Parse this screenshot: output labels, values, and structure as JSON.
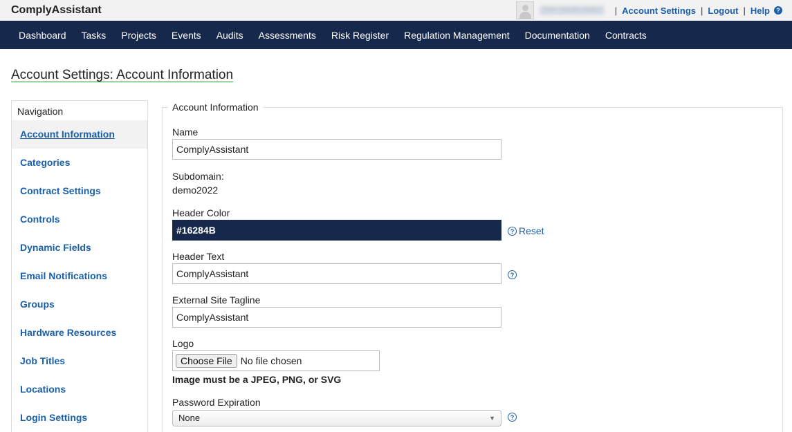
{
  "app": {
    "brand": "ComplyAssistant"
  },
  "topbar": {
    "username": "John Vandervalden",
    "separator": "|",
    "links": [
      {
        "label": "Account Settings"
      },
      {
        "label": "Logout"
      },
      {
        "label": "Help"
      }
    ],
    "help_icon_glyph": "?"
  },
  "nav": {
    "items": [
      {
        "label": "Dashboard"
      },
      {
        "label": "Tasks"
      },
      {
        "label": "Projects"
      },
      {
        "label": "Events"
      },
      {
        "label": "Audits"
      },
      {
        "label": "Assessments"
      },
      {
        "label": "Risk Register"
      },
      {
        "label": "Regulation Management"
      },
      {
        "label": "Documentation"
      },
      {
        "label": "Contracts"
      }
    ]
  },
  "page": {
    "title": "Account Settings: Account Information"
  },
  "sidebar": {
    "header": "Navigation",
    "items": [
      {
        "label": "Account Information"
      },
      {
        "label": "Categories"
      },
      {
        "label": "Contract Settings"
      },
      {
        "label": "Controls"
      },
      {
        "label": "Dynamic Fields"
      },
      {
        "label": "Email Notifications"
      },
      {
        "label": "Groups"
      },
      {
        "label": "Hardware Resources"
      },
      {
        "label": "Job Titles"
      },
      {
        "label": "Locations"
      },
      {
        "label": "Login Settings"
      }
    ]
  },
  "form": {
    "legend": "Account Information",
    "name": {
      "label": "Name",
      "value": "ComplyAssistant"
    },
    "subdomain": {
      "label": "Subdomain:",
      "value": "demo2022"
    },
    "header_color": {
      "label": "Header Color",
      "value": "#16284B",
      "reset_label": "Reset"
    },
    "header_text": {
      "label": "Header Text",
      "value": "ComplyAssistant"
    },
    "tagline": {
      "label": "External Site Tagline",
      "value": "ComplyAssistant"
    },
    "logo": {
      "label": "Logo",
      "button_label": "Choose File",
      "status": "No file chosen",
      "note": "Image must be a JPEG, PNG, or SVG"
    },
    "password_expiration": {
      "label": "Password Expiration",
      "selected": "None"
    }
  },
  "icons": {
    "question": "?",
    "dropdown_arrow": "▼"
  },
  "colors": {
    "header_bg": "#16284B",
    "link": "#1a5fa8",
    "title_underline": "#2a9d3a"
  }
}
